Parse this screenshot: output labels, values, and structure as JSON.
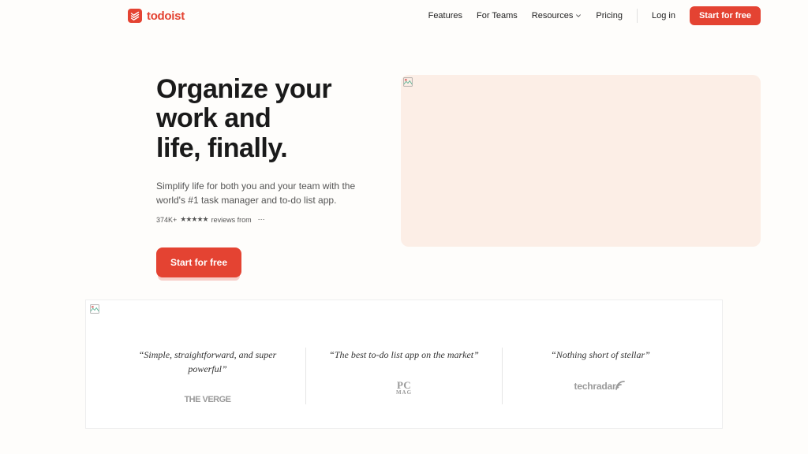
{
  "brand": {
    "name": "todoist"
  },
  "nav": {
    "features": "Features",
    "for_teams": "For Teams",
    "resources": "Resources",
    "pricing": "Pricing",
    "log_in": "Log in",
    "cta": "Start for free"
  },
  "hero": {
    "title_line1": "Organize your",
    "title_line2": "work and",
    "title_line3": "life, finally.",
    "subtitle": "Simplify life for both you and your team with the world's #1 task manager and to-do list app.",
    "reviews_count": "374K+",
    "reviews_stars": "★★★★★",
    "reviews_text": "reviews from",
    "cta": "Start for free"
  },
  "testimonials": [
    {
      "quote": "“Simple, straightforward, and super powerful”",
      "source": "THE VERGE",
      "logo": "verge"
    },
    {
      "quote": "“The best to-do list app on the market”",
      "source_line1": "PC",
      "source_line2": "MAG",
      "logo": "pcmag"
    },
    {
      "quote": "“Nothing short of stellar”",
      "source": "techradar",
      "logo": "techradar"
    }
  ]
}
